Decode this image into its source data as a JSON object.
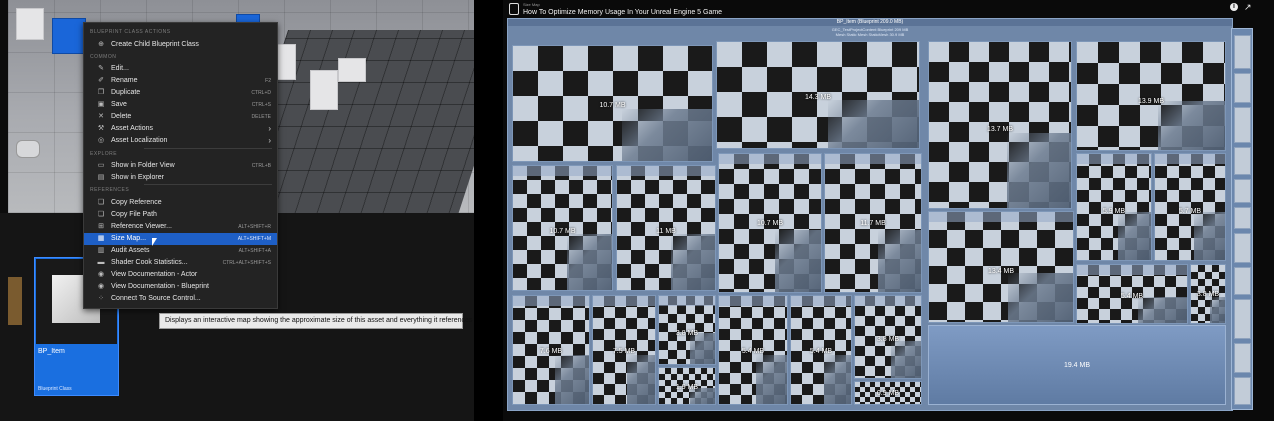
{
  "editor": {
    "context_menu": {
      "sections": {
        "blueprint": "BLUEPRINT CLASS ACTIONS",
        "common": "COMMON",
        "explore": "EXPLORE",
        "references": "REFERENCES"
      },
      "items": [
        {
          "label": "Create Child Blueprint Class",
          "shortcut": "",
          "icon": "blueprint-icon"
        },
        {
          "label": "Edit...",
          "shortcut": "",
          "icon": "edit-icon"
        },
        {
          "label": "Rename",
          "shortcut": "F2",
          "icon": "rename-icon"
        },
        {
          "label": "Duplicate",
          "shortcut": "CTRL+D",
          "icon": "duplicate-icon"
        },
        {
          "label": "Save",
          "shortcut": "CTRL+S",
          "icon": "save-icon"
        },
        {
          "label": "Delete",
          "shortcut": "DELETE",
          "icon": "delete-icon"
        },
        {
          "label": "Asset Actions",
          "shortcut": "",
          "icon": "wrench-icon"
        },
        {
          "label": "Asset Localization",
          "shortcut": "",
          "icon": "globe-icon"
        },
        {
          "label": "Show in Folder View",
          "shortcut": "CTRL+B",
          "icon": "folder-icon"
        },
        {
          "label": "Show in Explorer",
          "shortcut": "",
          "icon": "explorer-icon"
        },
        {
          "label": "Copy Reference",
          "shortcut": "",
          "icon": "copy-icon"
        },
        {
          "label": "Copy File Path",
          "shortcut": "",
          "icon": "copy-path-icon"
        },
        {
          "label": "Reference Viewer...",
          "shortcut": "ALT+SHIFT+R",
          "icon": "reference-icon"
        },
        {
          "label": "Size Map...",
          "shortcut": "ALT+SHIFT+M",
          "icon": "size-map-icon"
        },
        {
          "label": "Audit Assets",
          "shortcut": "ALT+SHIFT+A",
          "icon": "audit-icon"
        },
        {
          "label": "Shader Cook Statistics...",
          "shortcut": "CTRL+ALT+SHIFT+S",
          "icon": "shader-icon"
        },
        {
          "label": "View Documentation - Actor",
          "shortcut": "",
          "icon": "doc-icon"
        },
        {
          "label": "View Documentation - Blueprint",
          "shortcut": "",
          "icon": "doc-icon"
        },
        {
          "label": "Connect To Source Control...",
          "shortcut": "",
          "icon": "source-control-icon"
        }
      ]
    },
    "tooltip": "Displays an interactive map showing the approximate size of this asset and everything it references",
    "asset": {
      "name": "BP_Item",
      "type": "Blueprint Class"
    }
  },
  "video": {
    "channel": "Size Map",
    "title": "How To Optimize Memory Usage In Your Unreal Engine 5 Game",
    "size_map": {
      "title": "BP_Item (Blueprint 209.0 MB)",
      "subtitle1": "GEC_TestProjectContent  Blueprint 209 MB",
      "subtitle2": "Mesh Static Mesh  StaticMesh 30.9 MB",
      "tiles": [
        {
          "value": "10.7 MB"
        },
        {
          "value": "14.3 MB"
        },
        {
          "value": "13.7 MB"
        },
        {
          "value": "13.9 MB"
        },
        {
          "value": "10.7 MB"
        },
        {
          "value": "11 MB"
        },
        {
          "value": "10.7 MB"
        },
        {
          "value": "13.7 MB"
        },
        {
          "value": "11.7 MB"
        },
        {
          "value": "5.9 MB"
        },
        {
          "value": "5.7 MB"
        },
        {
          "value": "13.4 MB"
        },
        {
          "value": "5.4 MB"
        },
        {
          "value": "3.8 MB"
        },
        {
          "value": "7.6 MB"
        },
        {
          "value": "7.5 MB"
        },
        {
          "value": "3.8 MB"
        },
        {
          "value": "1.9 MB"
        },
        {
          "value": "5.4 MB"
        },
        {
          "value": "5.4 MB"
        },
        {
          "value": "3.8 MB"
        },
        {
          "value": "0.9 MB"
        },
        {
          "value": "19.4 MB"
        }
      ]
    }
  },
  "colors": {
    "accent": "#1e5fc6",
    "asset_card": "#1a6fe0",
    "size_map_bg": "#6f87a8"
  }
}
